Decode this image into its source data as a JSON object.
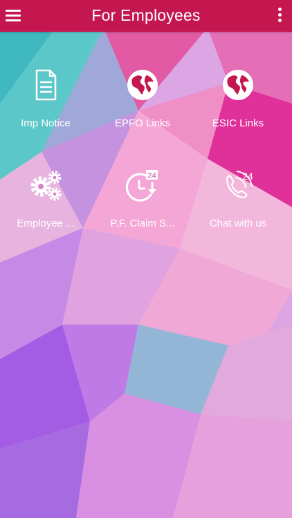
{
  "app_bar": {
    "title": "For Employees",
    "menu_icon": "hamburger-menu-icon",
    "overflow_icon": "more-vert-icon"
  },
  "colors": {
    "app_bar": "#c4174f",
    "tile_text": "#ffffff"
  },
  "tiles": [
    {
      "label": "Imp Notice",
      "icon": "document-icon"
    },
    {
      "label": "EPFO Links",
      "icon": "globe-icon"
    },
    {
      "label": "ESIC Links",
      "icon": "globe-icon"
    },
    {
      "label": "Employee ...",
      "icon": "gears-icon"
    },
    {
      "label": "P.F. Claim S...",
      "icon": "clock-24-icon"
    },
    {
      "label": "Chat with us",
      "icon": "phone-24-icon"
    }
  ]
}
